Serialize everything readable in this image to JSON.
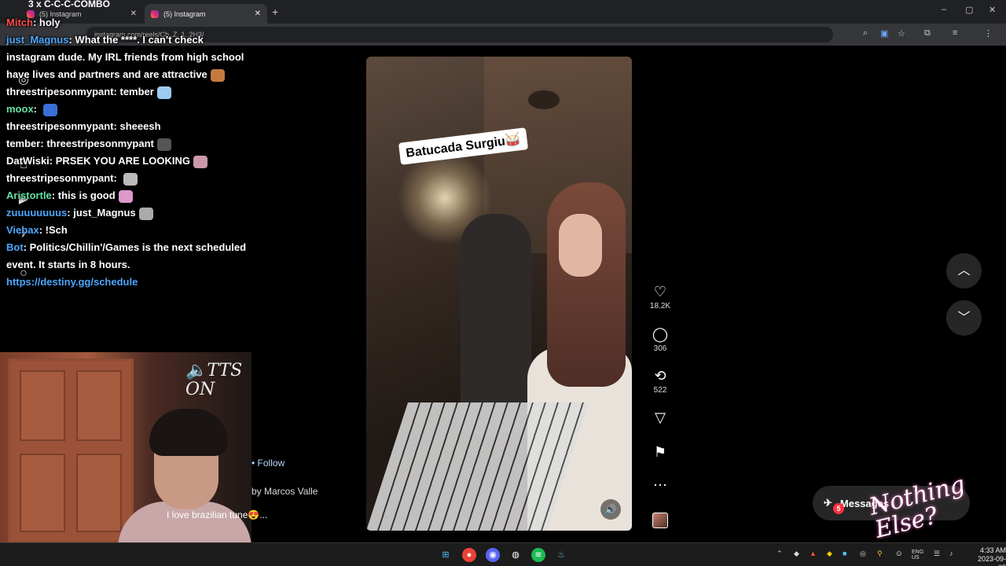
{
  "browser": {
    "tabs": [
      {
        "label": "(5) Instagram",
        "active": false
      },
      {
        "label": "(5) Instagram",
        "active": true
      }
    ],
    "address": "instagram.com/reels/Cb..Z..1..2H3/",
    "new_tab_label": "+",
    "window_controls": [
      "–",
      "▢",
      "✕"
    ]
  },
  "stream_overlay": {
    "combo_text": "3 x C-C-C-COMBO",
    "chat": [
      {
        "user": "Mitch",
        "user_color": "#ff4d4d",
        "text": "holy"
      },
      {
        "user": "just_Magnus",
        "user_color": "#4da6ff",
        "text": "What the ****. I can't check instagram dude. My IRL friends from high school have lives and partners and are attractive",
        "emote": true
      },
      {
        "user": "threestripesonmypant",
        "user_color": "#ffffff",
        "text": "tember",
        "emote": true
      },
      {
        "user": "moox",
        "user_color": "#66e0a3",
        "text": "",
        "emote": true
      },
      {
        "user": "threestripesonmypant",
        "user_color": "#ffffff",
        "text": "sheeesh"
      },
      {
        "user": "tember",
        "user_color": "#ffffff",
        "text": "threestripesonmypant",
        "emote": true
      },
      {
        "user": "DatWiski",
        "user_color": "#ffffff",
        "text": "PRSEK YOU ARE LOOKING",
        "emote": true
      },
      {
        "user": "threestripesonmypant",
        "user_color": "#ffffff",
        "text": "",
        "emote": true
      },
      {
        "user": "Aristortle",
        "user_color": "#66e0a3",
        "text": "this is good",
        "emote": true
      },
      {
        "user": "zuuuuuuuus",
        "user_color": "#4da6ff",
        "text": "just_Magnus",
        "emote": true
      },
      {
        "user": "Viebax",
        "user_color": "#4da6ff",
        "text": "!Sch"
      },
      {
        "user": "Bot",
        "user_color": "#4da6ff",
        "text": "Politics/Chillin'/Games is the next scheduled event. It starts in 8 hours."
      },
      {
        "user": "",
        "user_color": "#4da6ff",
        "text": "https://destiny.gg/schedule",
        "link": true
      }
    ],
    "tts_label": "TTS ON",
    "nothing_else": "Nothing Else?"
  },
  "reel": {
    "caption_sticker": "Batucada Surgiu🥁",
    "follow_label": "• Follow",
    "audio_label": "by Marcos Valle",
    "description": "I love brazilian tune😍...",
    "likes": "18.2K",
    "comments": "306",
    "reposts": "522"
  },
  "messages": {
    "label": "Messages",
    "badge": "5"
  },
  "taskbar": {
    "lang": "ENG US",
    "time": "4:33 AM",
    "date": "2023-09-05"
  }
}
